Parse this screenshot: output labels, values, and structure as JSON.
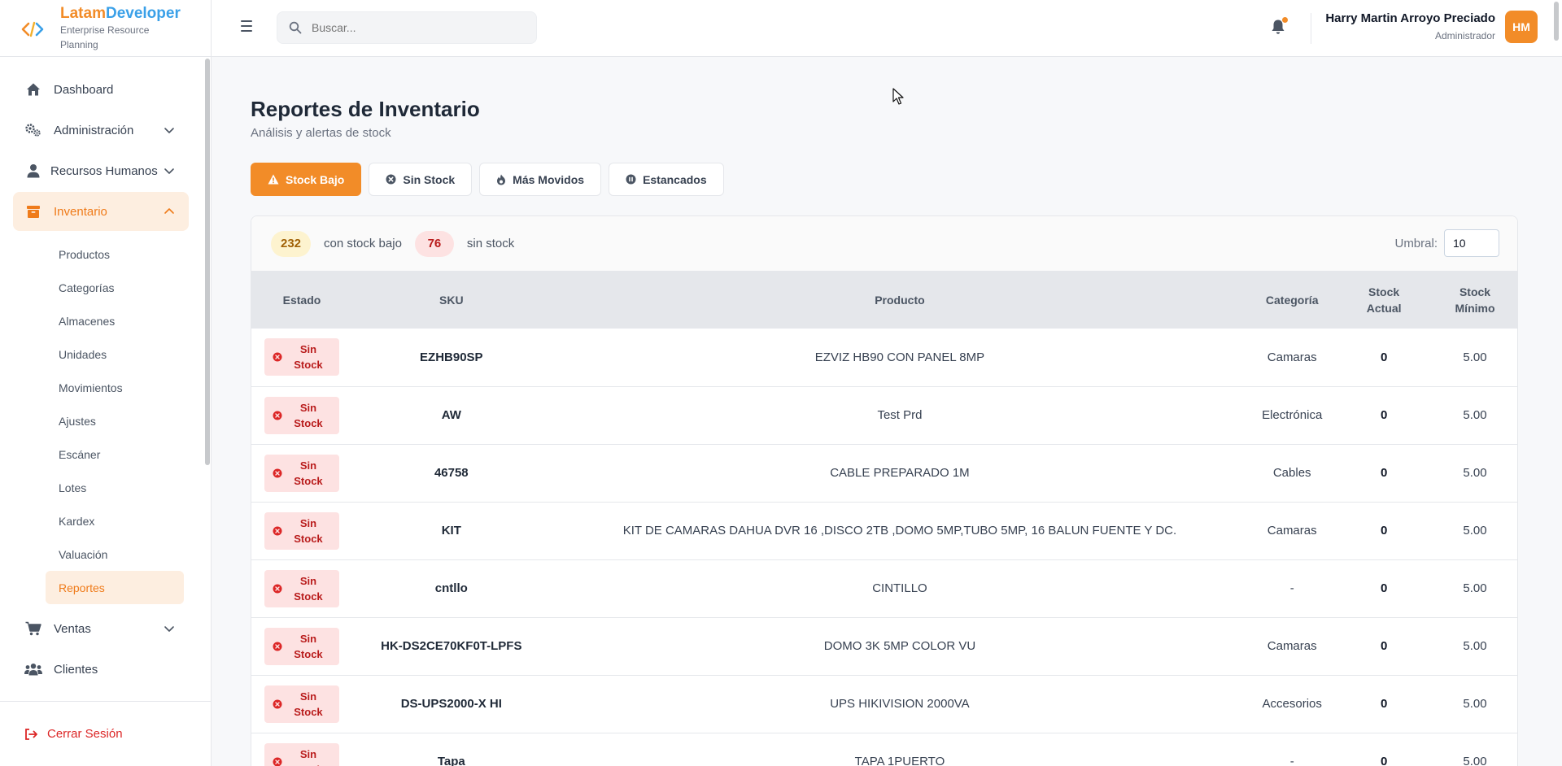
{
  "brand": {
    "name_part1": "Latam",
    "name_part2": "Developer",
    "subtitle": "Enterprise Resource Planning"
  },
  "sidebar": {
    "items": [
      {
        "label": "Dashboard",
        "icon": "home-icon"
      },
      {
        "label": "Administración",
        "icon": "gears-icon",
        "expandable": true
      },
      {
        "label": "Recursos Humanos",
        "icon": "user-icon",
        "expandable": true
      },
      {
        "label": "Inventario",
        "icon": "box-icon",
        "expandable": true,
        "expanded": true,
        "active": true
      },
      {
        "label": "Ventas",
        "icon": "cart-icon",
        "expandable": true
      },
      {
        "label": "Clientes",
        "icon": "users-icon"
      }
    ],
    "inventario_subitems": [
      "Productos",
      "Categorías",
      "Almacenes",
      "Unidades",
      "Movimientos",
      "Ajustes",
      "Escáner",
      "Lotes",
      "Kardex",
      "Valuación",
      "Reportes"
    ],
    "active_subitem": "Reportes",
    "logout_label": "Cerrar Sesión"
  },
  "topbar": {
    "search_placeholder": "Buscar...",
    "user_name": "Harry Martin Arroyo Preciado",
    "user_role": "Administrador",
    "avatar_initials": "HM"
  },
  "page": {
    "title": "Reportes de Inventario",
    "subtitle": "Análisis y alertas de stock",
    "tabs": [
      {
        "label": "Stock Bajo",
        "icon": "warning-icon",
        "active": true
      },
      {
        "label": "Sin Stock",
        "icon": "x-circle-icon"
      },
      {
        "label": "Más Movidos",
        "icon": "fire-icon"
      },
      {
        "label": "Estancados",
        "icon": "pause-circle-icon"
      }
    ]
  },
  "summary": {
    "low_count": "232",
    "low_label": "con stock bajo",
    "out_count": "76",
    "out_label": "sin stock",
    "threshold_label": "Umbral:",
    "threshold_value": "10"
  },
  "table": {
    "headers": [
      "Estado",
      "SKU",
      "Producto",
      "Categoría",
      "Stock Actual",
      "Stock Mínimo"
    ],
    "rows": [
      {
        "estado": "Sin Stock",
        "sku": "EZHB90SP",
        "producto": "EZVIZ HB90 CON PANEL 8MP",
        "categoria": "Camaras",
        "actual": "0",
        "minimo": "5.00"
      },
      {
        "estado": "Sin Stock",
        "sku": "AW",
        "producto": "Test Prd",
        "categoria": "Electrónica",
        "actual": "0",
        "minimo": "5.00"
      },
      {
        "estado": "Sin Stock",
        "sku": "46758",
        "producto": "CABLE PREPARADO 1M",
        "categoria": "Cables",
        "actual": "0",
        "minimo": "5.00"
      },
      {
        "estado": "Sin Stock",
        "sku": "KIT",
        "producto": "KIT DE CAMARAS DAHUA DVR 16 ,DISCO 2TB ,DOMO 5MP,TUBO 5MP, 16 BALUN FUENTE Y DC.",
        "categoria": "Camaras",
        "actual": "0",
        "minimo": "5.00"
      },
      {
        "estado": "Sin Stock",
        "sku": "cntllo",
        "producto": "CINTILLO",
        "categoria": "-",
        "actual": "0",
        "minimo": "5.00"
      },
      {
        "estado": "Sin Stock",
        "sku": "HK-DS2CE70KF0T-LPFS",
        "producto": "DOMO 3K 5MP COLOR VU",
        "categoria": "Camaras",
        "actual": "0",
        "minimo": "5.00"
      },
      {
        "estado": "Sin Stock",
        "sku": "DS-UPS2000-X HI",
        "producto": "UPS HIKIVISION 2000VA",
        "categoria": "Accesorios",
        "actual": "0",
        "minimo": "5.00"
      },
      {
        "estado": "Sin Stock",
        "sku": "Tapa",
        "producto": "TAPA 1PUERTO",
        "categoria": "-",
        "actual": "0",
        "minimo": "5.00"
      }
    ]
  },
  "colors": {
    "accent": "#f28c28",
    "danger": "#b91c1c",
    "danger_bg": "#fde2e2",
    "warning_bg": "#fdf3cf"
  }
}
